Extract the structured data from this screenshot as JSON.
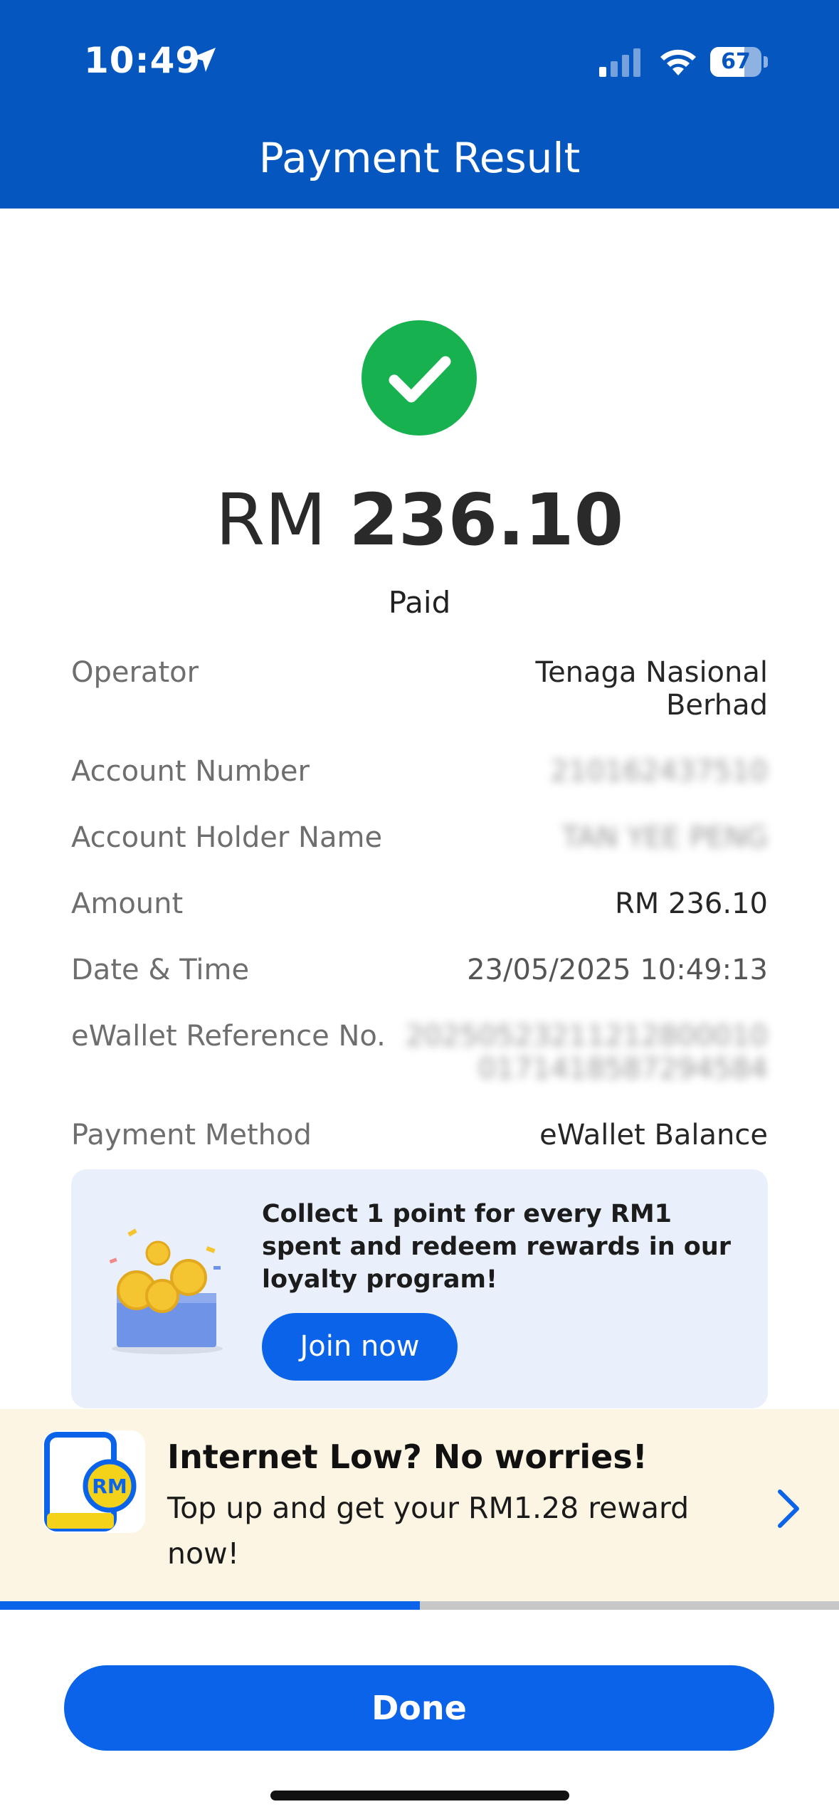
{
  "status_bar": {
    "time": "10:49",
    "battery": "67",
    "battery_level": 0.67
  },
  "header": {
    "title": "Payment Result"
  },
  "result": {
    "currency": "RM",
    "amount": "236.10",
    "status": "Paid"
  },
  "details": [
    {
      "label": "Operator",
      "value_lines": [
        "Tenaga Nasional",
        "Berhad"
      ],
      "blurred": false
    },
    {
      "label": "Account Number",
      "value_lines": [
        "210162437510"
      ],
      "blurred": true
    },
    {
      "label": "Account Holder Name",
      "value_lines": [
        "TAN YEE PENG"
      ],
      "blurred": true
    },
    {
      "label": "Amount",
      "value_lines": [
        "RM 236.10"
      ],
      "blurred": false
    },
    {
      "label": "Date & Time",
      "value_lines": [
        "23/05/2025 10:49:13"
      ],
      "blurred": false
    },
    {
      "label": "eWallet Reference No.",
      "value_lines": [
        "20250523211212800010",
        "0171418587294584"
      ],
      "blurred": true
    },
    {
      "label": "Payment Method",
      "value_lines": [
        "eWallet Balance"
      ],
      "blurred": false
    }
  ],
  "promo": {
    "text": "Collect 1 point for every RM1 spent and redeem rewards in our loyalty program!",
    "button": "Join now",
    "icon": "gift-box-coins-icon"
  },
  "banner": {
    "title": "Internet Low? No worries!",
    "subtitle": "Top up and get your RM1.28 reward now!",
    "icon": "phone-rm-icon",
    "icon_text": "RM",
    "progress": 0.5
  },
  "footer": {
    "done_label": "Done"
  },
  "colors": {
    "primary": "#0557bf",
    "button": "#0a63e8",
    "success": "#17b24f",
    "banner_bg": "#fdf5e3",
    "promo_bg": "#e9f0fb"
  }
}
